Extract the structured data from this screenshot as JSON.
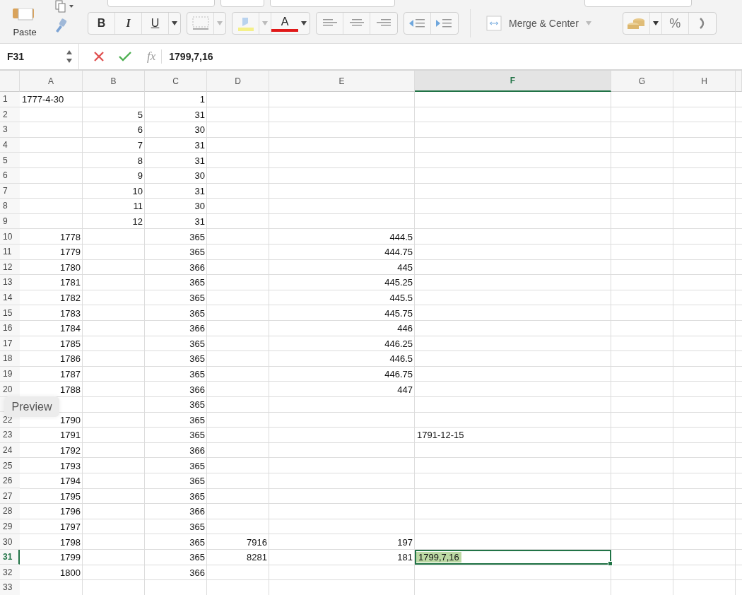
{
  "ribbon": {
    "paste_label": "Paste",
    "bold": "B",
    "italic": "I",
    "underline": "U",
    "font_color_letter": "A",
    "merge_label": "Merge & Center",
    "percent": "%"
  },
  "formula_bar": {
    "name_box": "F31",
    "function_label": "fx",
    "formula": "1799,7,16"
  },
  "sheet": {
    "columns": [
      {
        "label": "A",
        "selected": false
      },
      {
        "label": "B",
        "selected": false
      },
      {
        "label": "C",
        "selected": false
      },
      {
        "label": "D",
        "selected": false
      },
      {
        "label": "E",
        "selected": false
      },
      {
        "label": "F",
        "selected": true
      },
      {
        "label": "G",
        "selected": false
      },
      {
        "label": "H",
        "selected": false
      }
    ],
    "rows": [
      {
        "n": "1",
        "selected": false,
        "cells": [
          {
            "kind": "text",
            "text": "1777-4-30"
          },
          {
            "kind": "empty"
          },
          {
            "kind": "number",
            "text": "1"
          },
          {
            "kind": "empty"
          },
          {
            "kind": "empty"
          },
          {
            "kind": "empty"
          },
          {
            "kind": "empty"
          },
          {
            "kind": "empty"
          }
        ]
      },
      {
        "n": "2",
        "selected": false,
        "cells": [
          {
            "kind": "empty"
          },
          {
            "kind": "number",
            "text": "5"
          },
          {
            "kind": "number",
            "text": "31"
          },
          {
            "kind": "empty"
          },
          {
            "kind": "empty"
          },
          {
            "kind": "empty"
          },
          {
            "kind": "empty"
          },
          {
            "kind": "empty"
          }
        ]
      },
      {
        "n": "3",
        "selected": false,
        "cells": [
          {
            "kind": "empty"
          },
          {
            "kind": "number",
            "text": "6"
          },
          {
            "kind": "number",
            "text": "30"
          },
          {
            "kind": "empty"
          },
          {
            "kind": "empty"
          },
          {
            "kind": "empty"
          },
          {
            "kind": "empty"
          },
          {
            "kind": "empty"
          }
        ]
      },
      {
        "n": "4",
        "selected": false,
        "cells": [
          {
            "kind": "empty"
          },
          {
            "kind": "number",
            "text": "7"
          },
          {
            "kind": "number",
            "text": "31"
          },
          {
            "kind": "empty"
          },
          {
            "kind": "empty"
          },
          {
            "kind": "empty"
          },
          {
            "kind": "empty"
          },
          {
            "kind": "empty"
          }
        ]
      },
      {
        "n": "5",
        "selected": false,
        "cells": [
          {
            "kind": "empty"
          },
          {
            "kind": "number",
            "text": "8"
          },
          {
            "kind": "number",
            "text": "31"
          },
          {
            "kind": "empty"
          },
          {
            "kind": "empty"
          },
          {
            "kind": "empty"
          },
          {
            "kind": "empty"
          },
          {
            "kind": "empty"
          }
        ]
      },
      {
        "n": "6",
        "selected": false,
        "cells": [
          {
            "kind": "empty"
          },
          {
            "kind": "number",
            "text": "9"
          },
          {
            "kind": "number",
            "text": "30"
          },
          {
            "kind": "empty"
          },
          {
            "kind": "empty"
          },
          {
            "kind": "empty"
          },
          {
            "kind": "empty"
          },
          {
            "kind": "empty"
          }
        ]
      },
      {
        "n": "7",
        "selected": false,
        "cells": [
          {
            "kind": "empty"
          },
          {
            "kind": "number",
            "text": "10"
          },
          {
            "kind": "number",
            "text": "31"
          },
          {
            "kind": "empty"
          },
          {
            "kind": "empty"
          },
          {
            "kind": "empty"
          },
          {
            "kind": "empty"
          },
          {
            "kind": "empty"
          }
        ]
      },
      {
        "n": "8",
        "selected": false,
        "cells": [
          {
            "kind": "empty"
          },
          {
            "kind": "number",
            "text": "11"
          },
          {
            "kind": "number",
            "text": "30"
          },
          {
            "kind": "empty"
          },
          {
            "kind": "empty"
          },
          {
            "kind": "empty"
          },
          {
            "kind": "empty"
          },
          {
            "kind": "empty"
          }
        ]
      },
      {
        "n": "9",
        "selected": false,
        "cells": [
          {
            "kind": "empty"
          },
          {
            "kind": "number",
            "text": "12"
          },
          {
            "kind": "number",
            "text": "31"
          },
          {
            "kind": "empty"
          },
          {
            "kind": "empty"
          },
          {
            "kind": "empty"
          },
          {
            "kind": "empty"
          },
          {
            "kind": "empty"
          }
        ]
      },
      {
        "n": "10",
        "selected": false,
        "cells": [
          {
            "kind": "number",
            "text": "1778"
          },
          {
            "kind": "empty"
          },
          {
            "kind": "number",
            "text": "365"
          },
          {
            "kind": "empty"
          },
          {
            "kind": "number",
            "text": "444.5"
          },
          {
            "kind": "empty"
          },
          {
            "kind": "empty"
          },
          {
            "kind": "empty"
          }
        ]
      },
      {
        "n": "11",
        "selected": false,
        "cells": [
          {
            "kind": "number",
            "text": "1779"
          },
          {
            "kind": "empty"
          },
          {
            "kind": "number",
            "text": "365"
          },
          {
            "kind": "empty"
          },
          {
            "kind": "number",
            "text": "444.75"
          },
          {
            "kind": "empty"
          },
          {
            "kind": "empty"
          },
          {
            "kind": "empty"
          }
        ]
      },
      {
        "n": "12",
        "selected": false,
        "cells": [
          {
            "kind": "number",
            "text": "1780"
          },
          {
            "kind": "empty"
          },
          {
            "kind": "number",
            "text": "366"
          },
          {
            "kind": "empty"
          },
          {
            "kind": "number",
            "text": "445"
          },
          {
            "kind": "empty"
          },
          {
            "kind": "empty"
          },
          {
            "kind": "empty"
          }
        ]
      },
      {
        "n": "13",
        "selected": false,
        "cells": [
          {
            "kind": "number",
            "text": "1781"
          },
          {
            "kind": "empty"
          },
          {
            "kind": "number",
            "text": "365"
          },
          {
            "kind": "empty"
          },
          {
            "kind": "number",
            "text": "445.25"
          },
          {
            "kind": "empty"
          },
          {
            "kind": "empty"
          },
          {
            "kind": "empty"
          }
        ]
      },
      {
        "n": "14",
        "selected": false,
        "cells": [
          {
            "kind": "number",
            "text": "1782"
          },
          {
            "kind": "empty"
          },
          {
            "kind": "number",
            "text": "365"
          },
          {
            "kind": "empty"
          },
          {
            "kind": "number",
            "text": "445.5"
          },
          {
            "kind": "empty"
          },
          {
            "kind": "empty"
          },
          {
            "kind": "empty"
          }
        ]
      },
      {
        "n": "15",
        "selected": false,
        "cells": [
          {
            "kind": "number",
            "text": "1783"
          },
          {
            "kind": "empty"
          },
          {
            "kind": "number",
            "text": "365"
          },
          {
            "kind": "empty"
          },
          {
            "kind": "number",
            "text": "445.75"
          },
          {
            "kind": "empty"
          },
          {
            "kind": "empty"
          },
          {
            "kind": "empty"
          }
        ]
      },
      {
        "n": "16",
        "selected": false,
        "cells": [
          {
            "kind": "number",
            "text": "1784"
          },
          {
            "kind": "empty"
          },
          {
            "kind": "number",
            "text": "366"
          },
          {
            "kind": "empty"
          },
          {
            "kind": "number",
            "text": "446"
          },
          {
            "kind": "empty"
          },
          {
            "kind": "empty"
          },
          {
            "kind": "empty"
          }
        ]
      },
      {
        "n": "17",
        "selected": false,
        "cells": [
          {
            "kind": "number",
            "text": "1785"
          },
          {
            "kind": "empty"
          },
          {
            "kind": "number",
            "text": "365"
          },
          {
            "kind": "empty"
          },
          {
            "kind": "number",
            "text": "446.25"
          },
          {
            "kind": "empty"
          },
          {
            "kind": "empty"
          },
          {
            "kind": "empty"
          }
        ]
      },
      {
        "n": "18",
        "selected": false,
        "cells": [
          {
            "kind": "number",
            "text": "1786"
          },
          {
            "kind": "empty"
          },
          {
            "kind": "number",
            "text": "365"
          },
          {
            "kind": "empty"
          },
          {
            "kind": "number",
            "text": "446.5"
          },
          {
            "kind": "empty"
          },
          {
            "kind": "empty"
          },
          {
            "kind": "empty"
          }
        ]
      },
      {
        "n": "19",
        "selected": false,
        "cells": [
          {
            "kind": "number",
            "text": "1787"
          },
          {
            "kind": "empty"
          },
          {
            "kind": "number",
            "text": "365"
          },
          {
            "kind": "empty"
          },
          {
            "kind": "number",
            "text": "446.75"
          },
          {
            "kind": "empty"
          },
          {
            "kind": "empty"
          },
          {
            "kind": "empty"
          }
        ]
      },
      {
        "n": "20",
        "selected": false,
        "cells": [
          {
            "kind": "number",
            "text": "1788"
          },
          {
            "kind": "empty"
          },
          {
            "kind": "number",
            "text": "366"
          },
          {
            "kind": "empty"
          },
          {
            "kind": "number",
            "text": "447"
          },
          {
            "kind": "empty"
          },
          {
            "kind": "empty"
          },
          {
            "kind": "empty"
          }
        ]
      },
      {
        "cells": [
          {
            "kind": "empty"
          },
          {
            "kind": "empty"
          },
          {
            "kind": "number",
            "text": "365"
          },
          {
            "kind": "empty"
          },
          {
            "kind": "empty"
          },
          {
            "kind": "empty"
          },
          {
            "kind": "empty"
          },
          {
            "kind": "empty"
          }
        ]
      },
      {
        "n": "22",
        "selected": false,
        "cells": [
          {
            "kind": "number",
            "text": "1790"
          },
          {
            "kind": "empty"
          },
          {
            "kind": "number",
            "text": "365"
          },
          {
            "kind": "empty"
          },
          {
            "kind": "empty"
          },
          {
            "kind": "empty"
          },
          {
            "kind": "empty"
          },
          {
            "kind": "empty"
          }
        ]
      },
      {
        "n": "23",
        "selected": false,
        "cells": [
          {
            "kind": "number",
            "text": "1791"
          },
          {
            "kind": "empty"
          },
          {
            "kind": "number",
            "text": "365"
          },
          {
            "kind": "empty"
          },
          {
            "kind": "empty"
          },
          {
            "kind": "text",
            "text": "1791-12-15"
          },
          {
            "kind": "empty"
          },
          {
            "kind": "empty"
          }
        ]
      },
      {
        "n": "24",
        "selected": false,
        "cells": [
          {
            "kind": "number",
            "text": "1792"
          },
          {
            "kind": "empty"
          },
          {
            "kind": "number",
            "text": "366"
          },
          {
            "kind": "empty"
          },
          {
            "kind": "empty"
          },
          {
            "kind": "empty"
          },
          {
            "kind": "empty"
          },
          {
            "kind": "empty"
          }
        ]
      },
      {
        "n": "25",
        "selected": false,
        "cells": [
          {
            "kind": "number",
            "text": "1793"
          },
          {
            "kind": "empty"
          },
          {
            "kind": "number",
            "text": "365"
          },
          {
            "kind": "empty"
          },
          {
            "kind": "empty"
          },
          {
            "kind": "empty"
          },
          {
            "kind": "empty"
          },
          {
            "kind": "empty"
          }
        ]
      },
      {
        "n": "26",
        "selected": false,
        "cells": [
          {
            "kind": "number",
            "text": "1794"
          },
          {
            "kind": "empty"
          },
          {
            "kind": "number",
            "text": "365"
          },
          {
            "kind": "empty"
          },
          {
            "kind": "empty"
          },
          {
            "kind": "empty"
          },
          {
            "kind": "empty"
          },
          {
            "kind": "empty"
          }
        ]
      },
      {
        "n": "27",
        "selected": false,
        "cells": [
          {
            "kind": "number",
            "text": "1795"
          },
          {
            "kind": "empty"
          },
          {
            "kind": "number",
            "text": "365"
          },
          {
            "kind": "empty"
          },
          {
            "kind": "empty"
          },
          {
            "kind": "empty"
          },
          {
            "kind": "empty"
          },
          {
            "kind": "empty"
          }
        ]
      },
      {
        "n": "28",
        "selected": false,
        "cells": [
          {
            "kind": "number",
            "text": "1796"
          },
          {
            "kind": "empty"
          },
          {
            "kind": "number",
            "text": "366"
          },
          {
            "kind": "empty"
          },
          {
            "kind": "empty"
          },
          {
            "kind": "empty"
          },
          {
            "kind": "empty"
          },
          {
            "kind": "empty"
          }
        ]
      },
      {
        "n": "29",
        "selected": false,
        "cells": [
          {
            "kind": "number",
            "text": "1797"
          },
          {
            "kind": "empty"
          },
          {
            "kind": "number",
            "text": "365"
          },
          {
            "kind": "empty"
          },
          {
            "kind": "empty"
          },
          {
            "kind": "empty"
          },
          {
            "kind": "empty"
          },
          {
            "kind": "empty"
          }
        ]
      },
      {
        "n": "30",
        "selected": false,
        "cells": [
          {
            "kind": "number",
            "text": "1798"
          },
          {
            "kind": "empty"
          },
          {
            "kind": "number",
            "text": "365"
          },
          {
            "kind": "number",
            "text": "7916"
          },
          {
            "kind": "number",
            "text": "197"
          },
          {
            "kind": "empty"
          },
          {
            "kind": "empty"
          },
          {
            "kind": "empty"
          }
        ]
      },
      {
        "n": "31",
        "selected": true,
        "cells": [
          {
            "kind": "number",
            "text": "1799"
          },
          {
            "kind": "empty"
          },
          {
            "kind": "number",
            "text": "365"
          },
          {
            "kind": "number",
            "text": "8281"
          },
          {
            "kind": "number",
            "text": "181"
          },
          {
            "kind": "active",
            "text": "1799,7,16"
          },
          {
            "kind": "empty"
          },
          {
            "kind": "empty"
          }
        ]
      },
      {
        "n": "32",
        "selected": false,
        "cells": [
          {
            "kind": "number",
            "text": "1800"
          },
          {
            "kind": "empty"
          },
          {
            "kind": "number",
            "text": "366"
          },
          {
            "kind": "empty"
          },
          {
            "kind": "empty"
          },
          {
            "kind": "empty"
          },
          {
            "kind": "empty"
          },
          {
            "kind": "empty"
          }
        ]
      },
      {
        "n": "33",
        "selected": false,
        "cells": [
          {
            "kind": "empty"
          },
          {
            "kind": "empty"
          },
          {
            "kind": "empty"
          },
          {
            "kind": "empty"
          },
          {
            "kind": "empty"
          },
          {
            "kind": "empty"
          },
          {
            "kind": "empty"
          },
          {
            "kind": "empty"
          }
        ]
      }
    ]
  },
  "preview_tooltip": {
    "label": "Preview"
  }
}
